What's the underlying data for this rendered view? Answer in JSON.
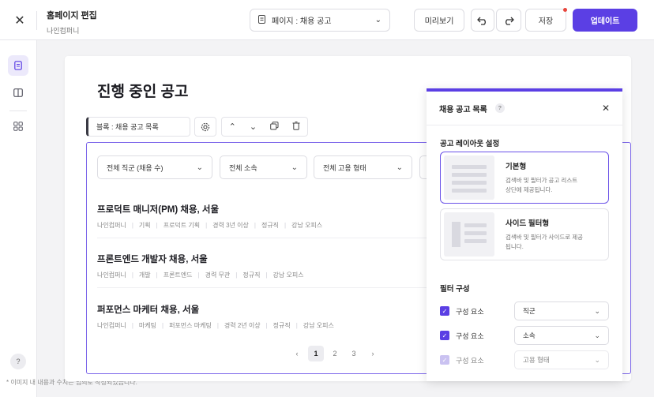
{
  "header": {
    "title": "홈페이지 편집",
    "subtitle": "나인컴퍼니",
    "page_select": "페이지 : 채용 공고",
    "preview_label": "미리보기",
    "save_label": "저장",
    "update_label": "업데이트"
  },
  "rail": {
    "help": "?"
  },
  "footnote": "* 이미지 내 내용과 수치는 임의로 작성되었습니다.",
  "page": {
    "title": "진행 중인 공고",
    "block_label": "블록 : 채용 공고 목록",
    "filters": [
      "전체 직군 (채용 수)",
      "전체 소속",
      "전체 고용 형태"
    ],
    "jobs": [
      {
        "title": "프로덕트 매니저(PM) 채용, 서울",
        "meta": [
          "나인컴퍼니",
          "기획",
          "프로덕트 기획",
          "경력 3년 이상",
          "정규직",
          "강남 오피스"
        ]
      },
      {
        "title": "프론트엔드 개발자 채용, 서울",
        "meta": [
          "나인컴퍼니",
          "개발",
          "프론트엔드",
          "경력 무관",
          "정규직",
          "강남 오피스"
        ]
      },
      {
        "title": "퍼포먼스 마케터 채용, 서울",
        "meta": [
          "나인컴퍼니",
          "마케팅",
          "퍼포먼스 마케팅",
          "경력 2년 이상",
          "정규직",
          "강남 오피스"
        ]
      }
    ],
    "pagination": {
      "pages": [
        "1",
        "2",
        "3"
      ],
      "current": "1"
    }
  },
  "panel": {
    "title": "채용 공고 목록",
    "help": "?",
    "layout_section": "공고 레이아웃 설정",
    "layouts": [
      {
        "name": "기본형",
        "desc": "검색바 및 필터가 공고 리스트 상단에 제공됩니다.",
        "selected": true
      },
      {
        "name": "사이드 필터형",
        "desc": "검색바 및 필터가 사이드로 제공됩니다.",
        "selected": false
      }
    ],
    "filter_section": "필터 구성",
    "filter_rows": [
      {
        "label": "구성 요소",
        "value": "직군",
        "checked": true
      },
      {
        "label": "구성 요소",
        "value": "소속",
        "checked": true
      },
      {
        "label": "구성 요소",
        "value": "고용 형태",
        "checked": true
      }
    ]
  },
  "colors": {
    "accent": "#5b3fe4",
    "save_dot": "#e8453c"
  }
}
